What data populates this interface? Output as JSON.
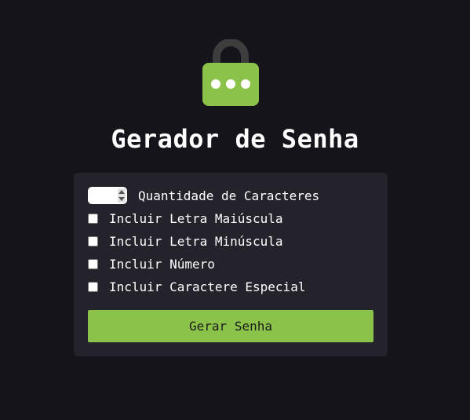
{
  "app": {
    "title": "Gerador de Senha",
    "icon": "lock-icon",
    "accent_color": "#8bc34a",
    "background_color": "#15141b",
    "panel_color": "#24232b"
  },
  "form": {
    "length": {
      "label": "Quantidade de Caracteres",
      "value": ""
    },
    "options": [
      {
        "label": "Incluir Letra Maiúscula",
        "checked": false
      },
      {
        "label": "Incluir Letra Minúscula",
        "checked": false
      },
      {
        "label": "Incluir Número",
        "checked": false
      },
      {
        "label": "Incluir Caractere Especial",
        "checked": false
      }
    ],
    "generate_label": "Gerar Senha"
  }
}
